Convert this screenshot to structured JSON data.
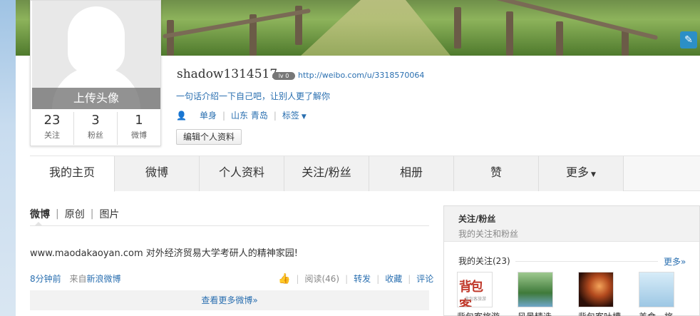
{
  "profile": {
    "upload_avatar": "上传头像",
    "stats": [
      {
        "count": "23",
        "label": "关注"
      },
      {
        "count": "3",
        "label": "粉丝"
      },
      {
        "count": "1",
        "label": "微博"
      }
    ],
    "name": "shadow1314517",
    "level_badge": "lv 0",
    "url": "http://weibo.com/u/3318570064",
    "intro": "一句话介绍一下自己吧，让别人更了解你",
    "relationship": "单身",
    "location": "山东 青岛",
    "tags": "标签",
    "edit_button": "编辑个人资料"
  },
  "tabs": [
    {
      "label": "我的主页"
    },
    {
      "label": "微博"
    },
    {
      "label": "个人资料"
    },
    {
      "label": "关注/粉丝"
    },
    {
      "label": "相册"
    },
    {
      "label": "赞"
    },
    {
      "label": "更多"
    }
  ],
  "feed": {
    "filters": [
      "微博",
      "原创",
      "图片"
    ],
    "post": {
      "text": "www.maodakaoyan.com 对外经济贸易大学考研人的精神家园!",
      "time": "8分钟前",
      "source_prefix": "来自",
      "source": "新浪微博",
      "read": "阅读(46)",
      "repost": "转发",
      "favorite": "收藏",
      "comment": "评论"
    },
    "more": "查看更多微博»"
  },
  "sidebar": {
    "title": "关注/粉丝",
    "subtitle": "我的关注和粉丝",
    "following_label": "我的关注(23)",
    "more": "更多»",
    "following": [
      {
        "name": "背包客旅游"
      },
      {
        "name": "风景精选"
      },
      {
        "name": "背包客吐槽"
      },
      {
        "name": "美食、旅"
      }
    ],
    "logo_text": "背包客",
    "logo_sub": "背包客旅游"
  }
}
